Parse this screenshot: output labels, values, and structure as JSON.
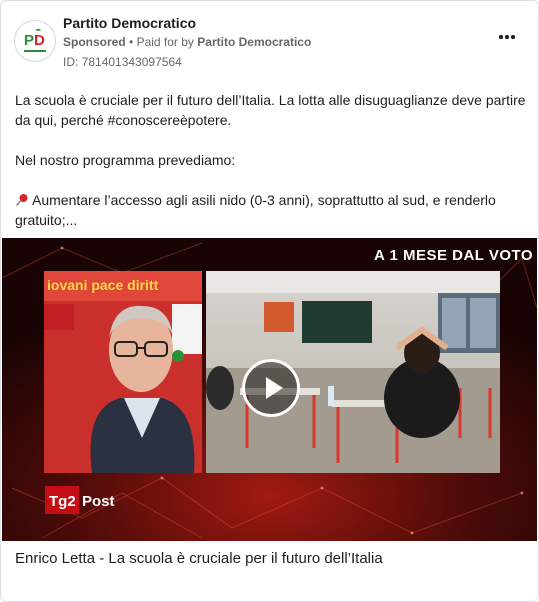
{
  "post": {
    "page_name": "Partito Democratico",
    "sponsored": "Sponsored",
    "paid_prefix": "Paid for by",
    "advertiser": "Partito Democratico",
    "ad_id": "ID: 781401343097564",
    "more_icon": "more-horizontal-icon",
    "text": {
      "paragraph1": "La scuola è cruciale per il futuro dell’Italia. La lotta alle disuguaglianze deve partire da qui, perché #conoscereèpotere.",
      "paragraph2": "Nel nostro programma prevediamo:",
      "paragraph3": "Aumentare l’accesso agli asili nido (0-3 anni), soprattutto al sud, e renderlo gratuito;...",
      "pin_icon": "pushpin-icon"
    }
  },
  "video": {
    "banner": "A 1 MESE DAL VOTO",
    "backdrop_text": "iovani pace diritt",
    "logo_tg": "Tg2",
    "logo_post": "Post",
    "play_icon": "play-icon"
  },
  "caption": "Enrico Letta - La scuola è cruciale per il futuro dell’Italia",
  "colors": {
    "text": "#1c1e21",
    "secondary": "#65676b",
    "pd_green": "#2c8f3a",
    "pd_red": "#d8232a",
    "tg2_red": "#c40d14"
  }
}
